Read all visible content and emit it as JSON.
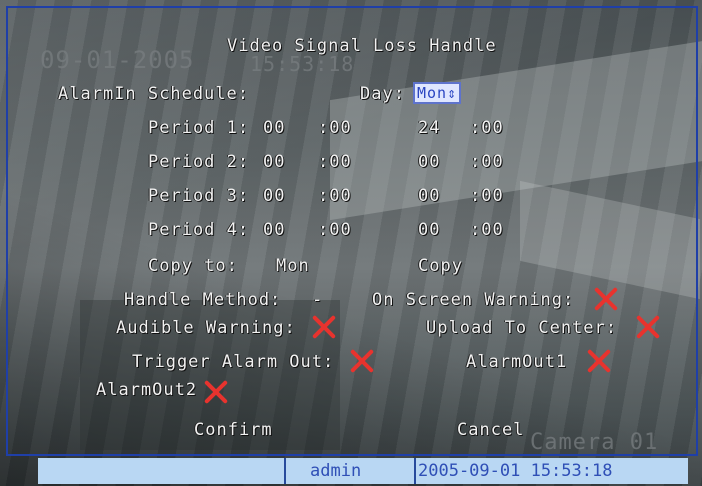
{
  "background": {
    "osd_date": "09-01-2005",
    "osd_time": "15:53:18",
    "camera_label": "Camera 01"
  },
  "dialog": {
    "title": "Video Signal Loss Handle",
    "alarmin_schedule_label": "AlarmIn Schedule:",
    "day_label": "Day:",
    "day_value": "Mon",
    "periods": [
      {
        "label": "Period 1:",
        "start_h": "00",
        "start_m": ":00",
        "end_h": "24",
        "end_m": ":00"
      },
      {
        "label": "Period 2:",
        "start_h": "00",
        "start_m": ":00",
        "end_h": "00",
        "end_m": ":00"
      },
      {
        "label": "Period 3:",
        "start_h": "00",
        "start_m": ":00",
        "end_h": "00",
        "end_m": ":00"
      },
      {
        "label": "Period 4:",
        "start_h": "00",
        "start_m": ":00",
        "end_h": "00",
        "end_m": ":00"
      }
    ],
    "copy_to_label": "Copy to:",
    "copy_to_value": "Mon",
    "copy_button": "Copy",
    "handle_method_label": "Handle Method:",
    "handle_method_sep": "-",
    "on_screen_warning_label": "On Screen Warning:",
    "audible_warning_label": "Audible Warning:",
    "upload_to_center_label": "Upload To Center:",
    "trigger_alarm_out_label": "Trigger Alarm Out:",
    "alarmout1_label": "AlarmOut1",
    "alarmout2_label": "AlarmOut2",
    "confirm_button": "Confirm",
    "cancel_button": "Cancel",
    "checkbox_states": {
      "on_screen_warning": "unchecked",
      "audible_warning": "unchecked",
      "upload_to_center": "unchecked",
      "trigger_alarm_out": "unchecked",
      "alarmout1": "unchecked",
      "alarmout2": "unchecked"
    },
    "colors": {
      "frame": "#1f3fa8",
      "cross": "#e8332e",
      "statusbar": "#b9d7f3",
      "status_text": "#2f4fb6"
    }
  },
  "statusbar": {
    "user": "admin",
    "datetime": "2005-09-01 15:53:18"
  }
}
